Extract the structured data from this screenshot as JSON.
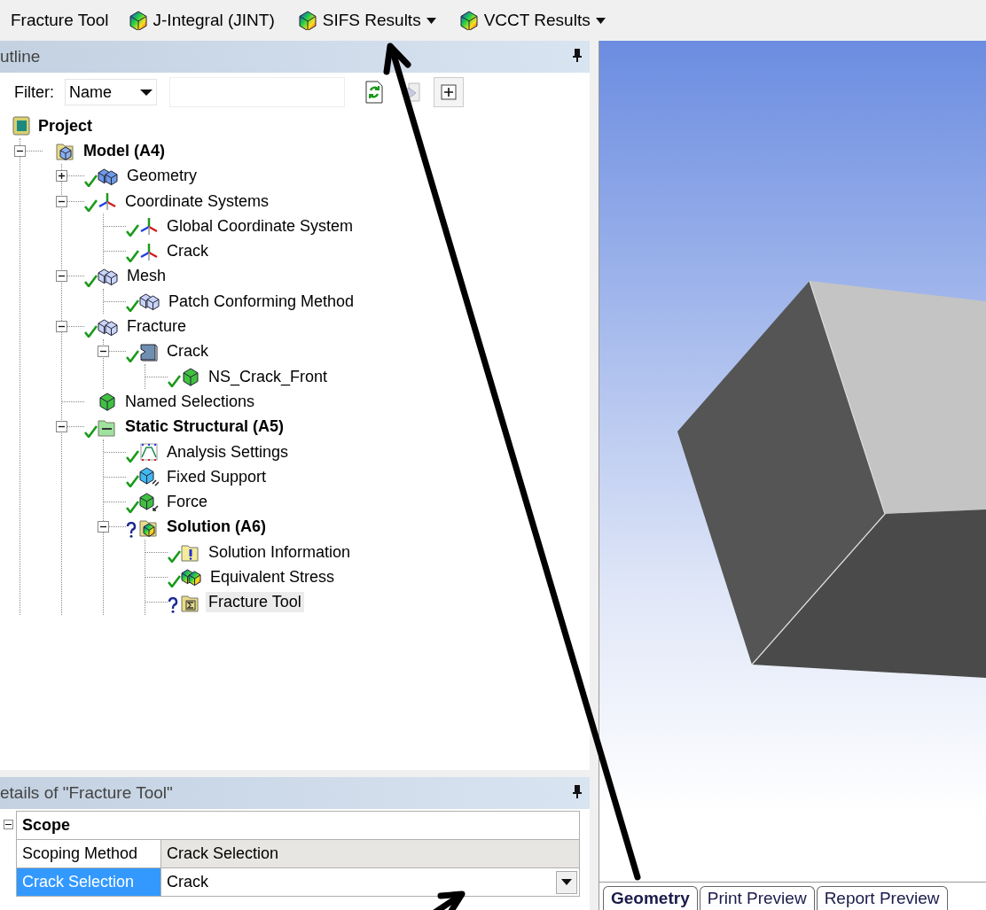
{
  "toolbar": {
    "title": "Fracture Tool",
    "buttons": [
      {
        "label": "J-Integral (JINT)",
        "dropdown": false
      },
      {
        "label": "SIFS Results",
        "dropdown": true
      },
      {
        "label": "VCCT Results",
        "dropdown": true
      }
    ]
  },
  "outline": {
    "title": "utline",
    "filter": {
      "label": "Filter:",
      "value": "Name"
    },
    "tree": [
      {
        "label": "Project",
        "kind": "project",
        "bold": true,
        "selected": false,
        "children": [
          {
            "label": "Model (A4)",
            "kind": "model",
            "bold": true,
            "selected": false,
            "expanded": true,
            "children": [
              {
                "label": "Geometry",
                "kind": "geometry",
                "solved": true,
                "selected": false,
                "expanded": false
              },
              {
                "label": "Coordinate Systems",
                "kind": "coords",
                "solved": true,
                "selected": false,
                "expanded": true,
                "children": [
                  {
                    "label": "Global Coordinate System",
                    "kind": "coords",
                    "solved": true,
                    "selected": false
                  },
                  {
                    "label": "Crack",
                    "kind": "coords",
                    "solved": true,
                    "selected": false
                  }
                ]
              },
              {
                "label": "Mesh",
                "kind": "mesh",
                "solved": true,
                "selected": false,
                "expanded": true,
                "children": [
                  {
                    "label": "Patch Conforming Method",
                    "kind": "mesh",
                    "solved": true,
                    "selected": false
                  }
                ]
              },
              {
                "label": "Fracture",
                "kind": "mesh",
                "solved": true,
                "selected": false,
                "expanded": true,
                "children": [
                  {
                    "label": "Crack",
                    "kind": "crack",
                    "solved": true,
                    "selected": false,
                    "expanded": true,
                    "children": [
                      {
                        "label": "NS_Crack_Front",
                        "kind": "named",
                        "solved": true,
                        "selected": false
                      }
                    ]
                  }
                ]
              },
              {
                "label": "Named Selections",
                "kind": "named",
                "selected": false
              },
              {
                "label": "Static Structural (A5)",
                "kind": "static",
                "bold": true,
                "solved": true,
                "selected": false,
                "expanded": true,
                "children": [
                  {
                    "label": "Analysis Settings",
                    "kind": "analysis",
                    "solved": true,
                    "selected": false
                  },
                  {
                    "label": "Fixed Support",
                    "kind": "support",
                    "solved": true,
                    "selected": false
                  },
                  {
                    "label": "Force",
                    "kind": "force",
                    "solved": true,
                    "selected": false
                  },
                  {
                    "label": "Solution (A6)",
                    "kind": "solution",
                    "bold": true,
                    "solved": false,
                    "selected": false,
                    "expanded": true,
                    "children": [
                      {
                        "label": "Solution Information",
                        "kind": "info",
                        "solved": true,
                        "selected": false
                      },
                      {
                        "label": "Equivalent Stress",
                        "kind": "stress",
                        "solved": true,
                        "selected": false
                      },
                      {
                        "label": "Fracture Tool",
                        "kind": "tool",
                        "solved": false,
                        "selected": true
                      }
                    ]
                  }
                ]
              }
            ]
          }
        ]
      }
    ]
  },
  "details": {
    "title": "etails of \"Fracture Tool\"",
    "group": {
      "label": "Scope",
      "expanded": true
    },
    "rows": [
      {
        "label": "Scoping Method",
        "value": "Crack Selection",
        "kind": "readonly",
        "selected": false
      },
      {
        "label": "Crack Selection",
        "value": "Crack",
        "kind": "dropdown",
        "selected": true
      }
    ]
  },
  "viewport": {
    "tabs": [
      {
        "label": "Geometry",
        "selected": true
      },
      {
        "label": "Print Preview",
        "selected": false
      },
      {
        "label": "Report Preview",
        "selected": false
      }
    ]
  }
}
